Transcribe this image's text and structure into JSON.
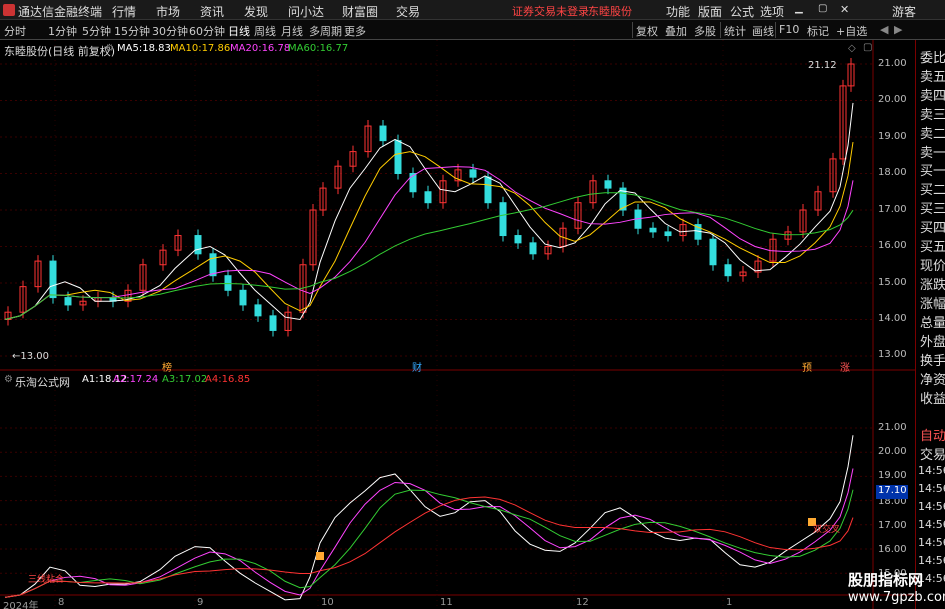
{
  "menu": {
    "app_name": "通达信金融终端",
    "items": [
      "行情",
      "市场",
      "资讯",
      "发现",
      "问小达",
      "财富圈",
      "交易"
    ],
    "notice": "证券交易未登录",
    "stock": "东睦股份",
    "right_items": [
      "功能",
      "版面",
      "公式",
      "选项"
    ],
    "guest": "游客"
  },
  "toolbar": {
    "periods": [
      "分时",
      "1分钟",
      "5分钟",
      "15分钟",
      "30分钟",
      "60分钟",
      "日线",
      "周线",
      "月线",
      "多周期",
      "更多"
    ],
    "active": "日线",
    "right": [
      "复权",
      "叠加",
      "多股",
      "统计",
      "画线",
      "F10",
      "标记",
      "+自选"
    ]
  },
  "main_chart": {
    "title": "东睦股份(日线 前复权)",
    "ma": [
      {
        "label": "MA5:",
        "value": "18.83",
        "color": "#ffffff"
      },
      {
        "label": "MA10:",
        "value": "17.86",
        "color": "#ffcc00"
      },
      {
        "label": "MA20:",
        "value": "16.78",
        "color": "#ff44ff"
      },
      {
        "label": "MA60:",
        "value": "16.77",
        "color": "#33cc33"
      }
    ],
    "y_ticks": [
      "21.00",
      "20.00",
      "19.00",
      "18.00",
      "17.00",
      "16.00",
      "15.00",
      "14.00",
      "13.00"
    ],
    "high_label": "21.12",
    "low_label": "13.00",
    "markers": [
      {
        "text": "榜",
        "color": "#ffaa33"
      },
      {
        "text": "财",
        "color": "#33aaff"
      },
      {
        "text": "预",
        "color": "#ffaa33"
      },
      {
        "text": "涨",
        "color": "#ff5555"
      }
    ]
  },
  "indicator": {
    "title": "乐淘公式网",
    "lines": [
      {
        "label": "A1:",
        "value": "18.12",
        "color": "#ffffff"
      },
      {
        "label": "A2:",
        "value": "17.24",
        "color": "#ff44ff"
      },
      {
        "label": "A3:",
        "value": "17.02",
        "color": "#33cc33"
      },
      {
        "label": "A4:",
        "value": "16.85",
        "color": "#ff3333"
      }
    ],
    "y_ticks": [
      "21.00",
      "20.00",
      "19.00",
      "18.00",
      "17.00",
      "16.00",
      "15.00"
    ],
    "cursor_value": "17.10",
    "label_left": "三线粘合",
    "label_right": "双交叉"
  },
  "x_axis": [
    "2024年",
    "8",
    "9",
    "10",
    "11",
    "12",
    "1"
  ],
  "sidebar": [
    "委比",
    "卖五",
    "卖四",
    "卖三",
    "卖二",
    "卖一",
    "买一",
    "买二",
    "买三",
    "买四",
    "买五",
    "现价",
    "涨跌",
    "涨幅",
    "总量",
    "外盘",
    "换手",
    "净资",
    "收益",
    "自动",
    "交易"
  ],
  "sidebar_times": [
    "14:56",
    "14:56",
    "14:56",
    "14:56",
    "14:56",
    "14:56",
    "14:56"
  ],
  "watermark": {
    "line1": "股朋指标网",
    "line2": "www.7gpzb.com"
  }
}
